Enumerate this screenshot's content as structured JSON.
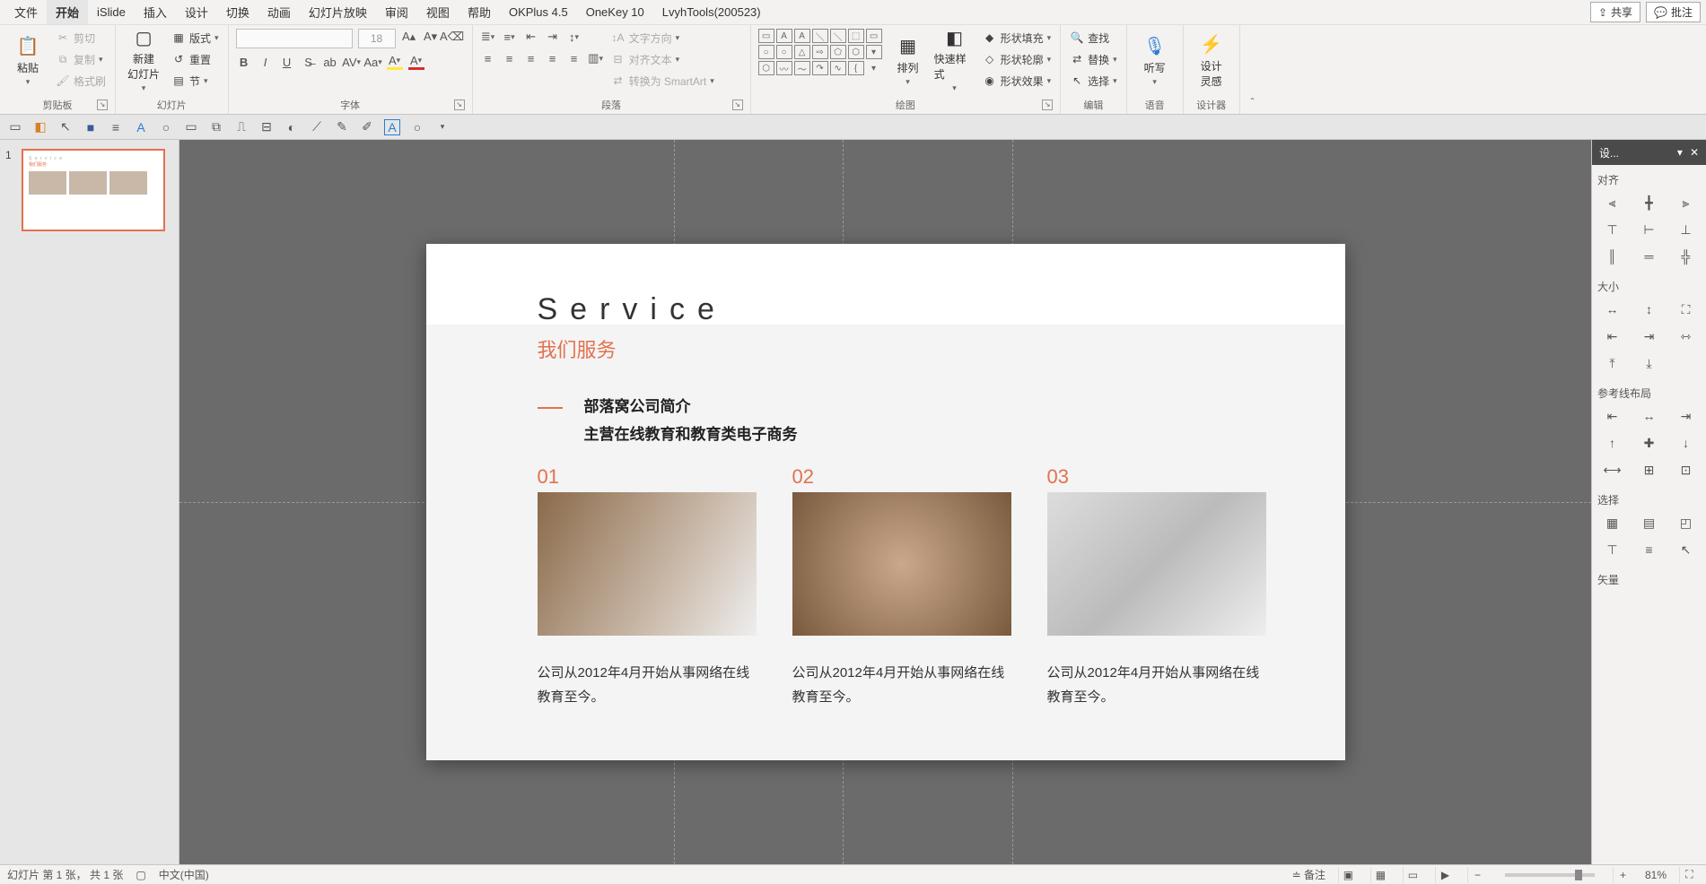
{
  "menubar": {
    "tabs": [
      "文件",
      "开始",
      "iSlide",
      "插入",
      "设计",
      "切换",
      "动画",
      "幻灯片放映",
      "审阅",
      "视图",
      "帮助",
      "OKPlus 4.5",
      "OneKey 10",
      "LvyhTools(200523)"
    ],
    "active_index": 1,
    "share": "共享",
    "comment": "批注"
  },
  "ribbon": {
    "clipboard": {
      "label": "剪贴板",
      "paste": "粘贴",
      "cut": "剪切",
      "copy": "复制",
      "format_painter": "格式刷"
    },
    "slides": {
      "label": "幻灯片",
      "new_slide": "新建\n幻灯片",
      "layout": "版式",
      "reset": "重置",
      "section": "节"
    },
    "font": {
      "label": "字体",
      "size_placeholder": "18"
    },
    "paragraph": {
      "label": "段落",
      "text_direction": "文字方向",
      "align_text": "对齐文本",
      "convert_smartart": "转换为 SmartArt"
    },
    "drawing": {
      "label": "绘图",
      "arrange": "排列",
      "quick_styles": "快速样式",
      "shape_fill": "形状填充",
      "shape_outline": "形状轮廓",
      "shape_effects": "形状效果"
    },
    "editing": {
      "label": "编辑",
      "find": "查找",
      "replace": "替换",
      "select": "选择"
    },
    "voice": {
      "label": "语音",
      "dictate": "听写"
    },
    "designer": {
      "label": "设计器",
      "ideas": "设计\n灵感"
    }
  },
  "thumbs": {
    "n1": "1"
  },
  "slide": {
    "title_en": "Service",
    "title_cn": "我们服务",
    "intro1": "部落窝公司简介",
    "intro2": "主营在线教育和教育类电子商务",
    "cols": [
      {
        "num": "01",
        "desc": "公司从2012年4月开始从事网络在线教育至今。"
      },
      {
        "num": "02",
        "desc": "公司从2012年4月开始从事网络在线教育至今。"
      },
      {
        "num": "03",
        "desc": "公司从2012年4月开始从事网络在线教育至今。"
      }
    ]
  },
  "pane": {
    "title": "设...",
    "sections": {
      "align": "对齐",
      "size": "大小",
      "guides": "参考线布局",
      "select": "选择",
      "vector": "矢量"
    }
  },
  "status": {
    "slide_info": "幻灯片 第 1 张， 共 1 张",
    "lang": "中文(中国)",
    "notes": "备注",
    "zoom": "81%"
  }
}
